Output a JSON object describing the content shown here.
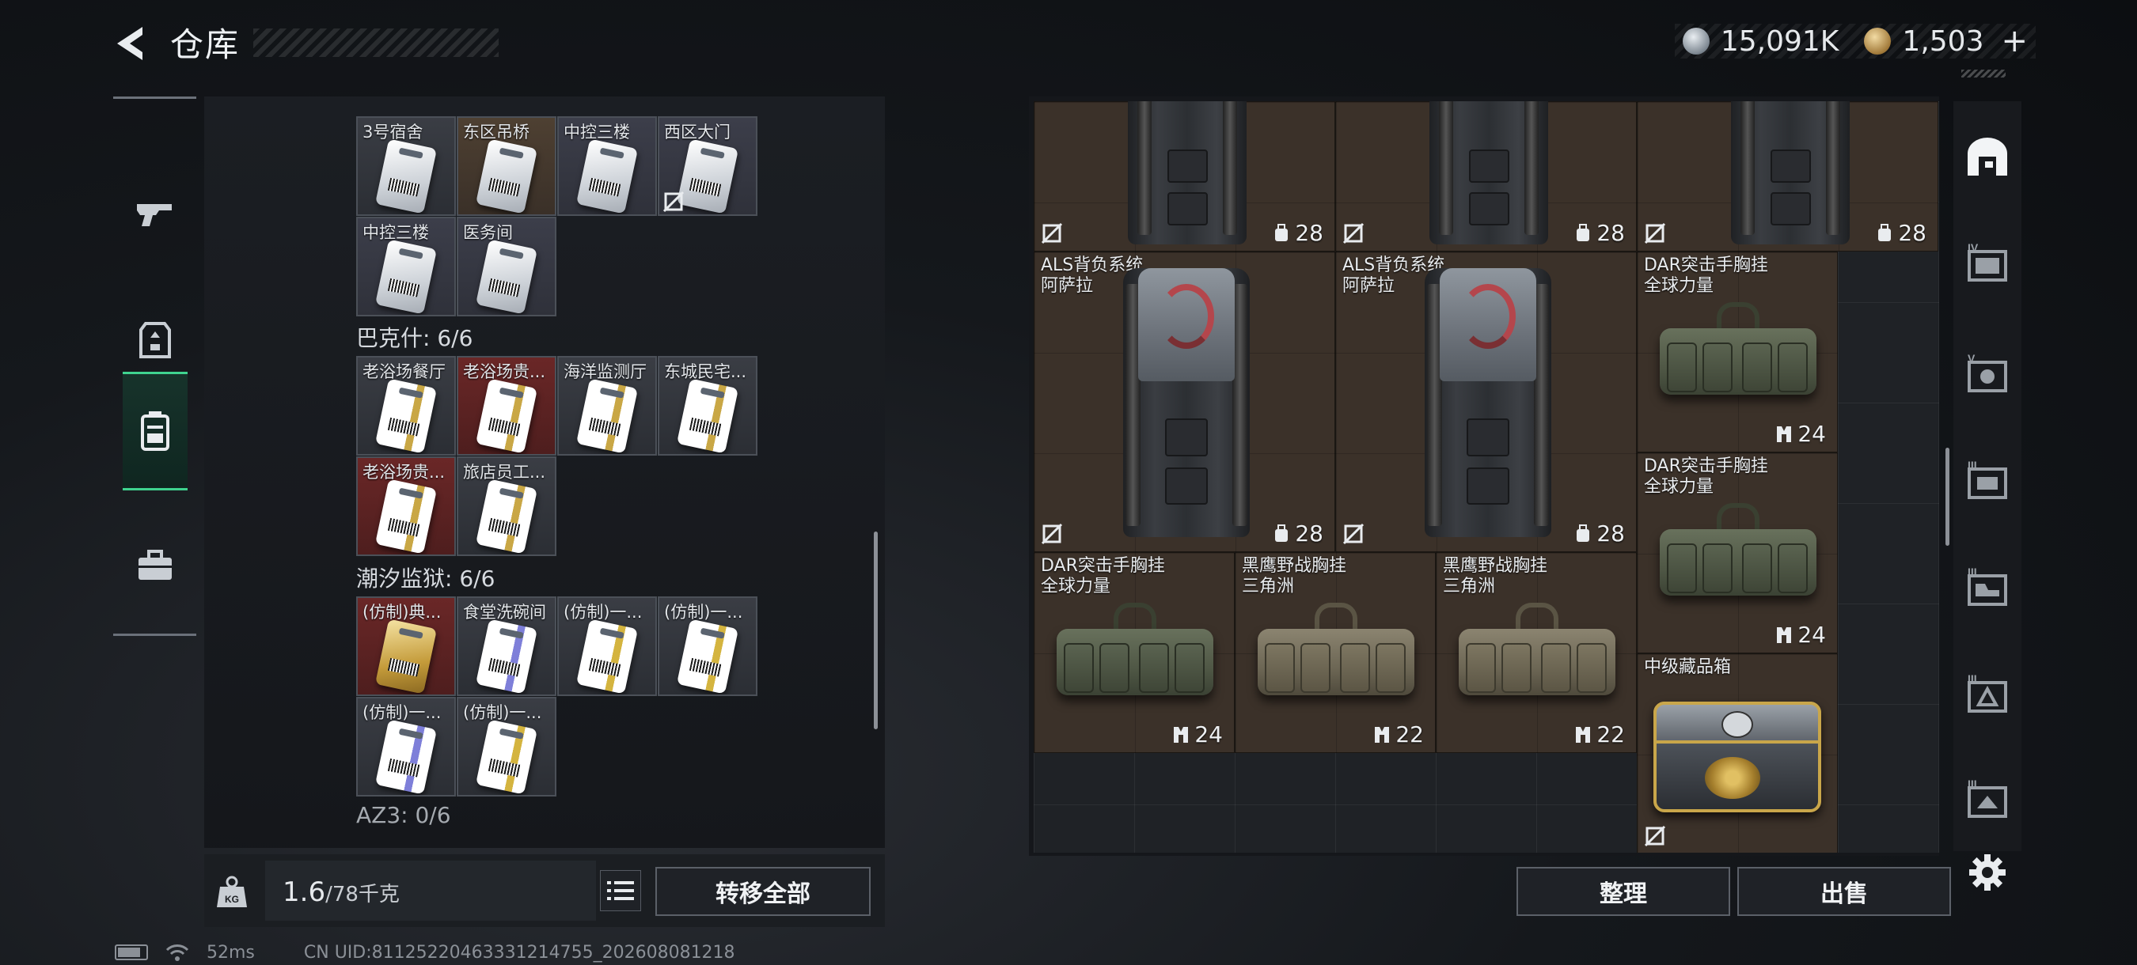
{
  "header": {
    "title": "仓库",
    "currency_silver": "15,091K",
    "currency_gold": "1,503",
    "currency_gold_plus": "+"
  },
  "left_rail": {
    "items": [
      "gun-icon",
      "armor-icon",
      "backpack-icon",
      "briefcase-icon"
    ],
    "active_index": 2
  },
  "bag": {
    "top_cards": [
      {
        "name": "3号宿舍",
        "tone": "gray"
      },
      {
        "name": "东区吊桥",
        "tone": "brown"
      },
      {
        "name": "中控三楼",
        "tone": "lav"
      },
      {
        "name": "西区大门",
        "tone": "lav",
        "locked": true
      },
      {
        "name": "中控三楼",
        "tone": "lav"
      },
      {
        "name": "医务间",
        "tone": "lav"
      }
    ],
    "group_bakeshi": {
      "label": "巴克什: 6/6",
      "cards": [
        {
          "name": "老浴场餐厅",
          "tone": "gray"
        },
        {
          "name": "老浴场贵...",
          "tone": "red"
        },
        {
          "name": "海洋监测厅",
          "tone": "gray"
        },
        {
          "name": "东城民宅...",
          "tone": "gray"
        },
        {
          "name": "老浴场贵...",
          "tone": "red"
        },
        {
          "name": "旅店员工...",
          "tone": "gray"
        }
      ]
    },
    "group_chaoxi": {
      "label": "潮汐监狱: 6/6",
      "cards": [
        {
          "name": "(仿制)典...",
          "tone": "red"
        },
        {
          "name": "食堂洗碗间",
          "tone": "gray"
        },
        {
          "name": "(仿制)一...",
          "tone": "gray"
        },
        {
          "name": "(仿制)一...",
          "tone": "gray"
        },
        {
          "name": "(仿制)一...",
          "tone": "gray"
        },
        {
          "name": "(仿制)一...",
          "tone": "gray"
        }
      ]
    },
    "group_az3": {
      "label": "AZ3: 0/6"
    },
    "weight_current": "1.6",
    "weight_capacity": "/78千克",
    "transfer_all_label": "转移全部"
  },
  "storage": {
    "items": [
      {
        "name_line1": "",
        "name_line2": "",
        "capacity": "28",
        "kind": "backpack"
      },
      {
        "name_line1": "",
        "name_line2": "",
        "capacity": "28",
        "kind": "backpack"
      },
      {
        "name_line1": "",
        "name_line2": "",
        "capacity": "28",
        "kind": "backpack"
      },
      {
        "name_line1": "ALS背负系统",
        "name_line2": "阿萨拉",
        "capacity": "28",
        "kind": "backpack"
      },
      {
        "name_line1": "ALS背负系统",
        "name_line2": "阿萨拉",
        "capacity": "28",
        "kind": "backpack"
      },
      {
        "name_line1": "DAR突击手胸挂",
        "name_line2": "全球力量",
        "capacity": "24",
        "kind": "rig"
      },
      {
        "name_line1": "DAR突击手胸挂",
        "name_line2": "全球力量",
        "capacity": "24",
        "kind": "rig"
      },
      {
        "name_line1": "DAR突击手胸挂",
        "name_line2": "全球力量",
        "capacity": "24",
        "kind": "rig"
      },
      {
        "name_line1": "黑鹰野战胸挂",
        "name_line2": "三角洲",
        "capacity": "22",
        "kind": "rig"
      },
      {
        "name_line1": "黑鹰野战胸挂",
        "name_line2": "三角洲",
        "capacity": "22",
        "kind": "rig"
      },
      {
        "name_line1": "中级藏品箱",
        "name_line2": "",
        "capacity": "",
        "kind": "safe"
      }
    ],
    "sort_label": "整理",
    "sell_label": "出售"
  },
  "right_rail": {
    "items": [
      "home-icon",
      "IV",
      "V",
      "III",
      "III",
      "III",
      "III"
    ],
    "settings": "gear-icon"
  },
  "status_bar": {
    "ping": "52ms",
    "uid": "CN UID:81125220463331214755_202608081218"
  }
}
